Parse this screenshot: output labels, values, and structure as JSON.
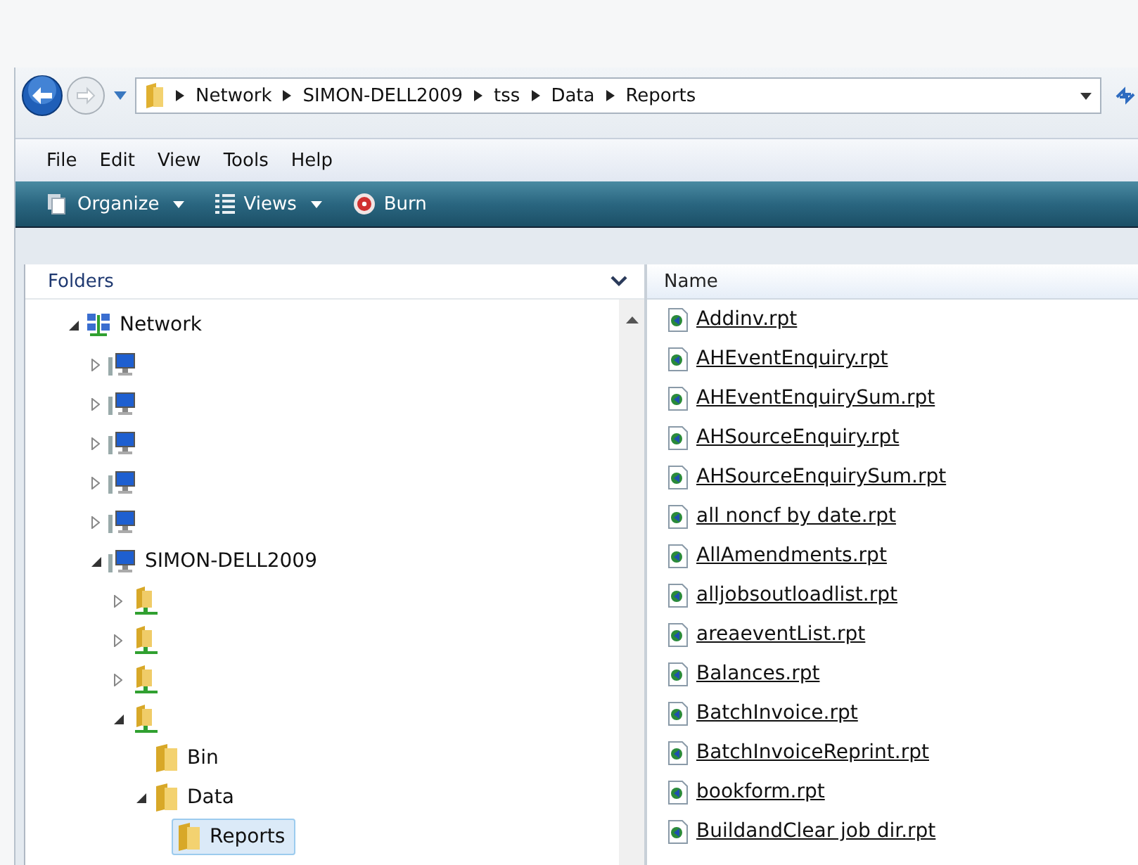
{
  "address_bar": {
    "crumbs": [
      "Network",
      "SIMON-DELL2009",
      "tss",
      "Data",
      "Reports"
    ]
  },
  "menu": [
    "File",
    "Edit",
    "View",
    "Tools",
    "Help"
  ],
  "toolbar": [
    {
      "kind": "organize",
      "label": "Organize",
      "dropdown": true
    },
    {
      "kind": "views",
      "label": "Views",
      "dropdown": true
    },
    {
      "kind": "burn",
      "label": "Burn",
      "dropdown": false
    }
  ],
  "folders_pane": {
    "title": "Folders",
    "tree": [
      {
        "kind": "network",
        "label": "Network",
        "expanded": true,
        "selected": false,
        "children": [
          {
            "kind": "computer",
            "expanded": false,
            "selected": false
          },
          {
            "kind": "computer",
            "expanded": false,
            "selected": false
          },
          {
            "kind": "computer",
            "expanded": false,
            "selected": false
          },
          {
            "kind": "computer",
            "expanded": false,
            "selected": false
          },
          {
            "kind": "computer",
            "expanded": false,
            "selected": false
          },
          {
            "kind": "computer",
            "label": "SIMON-DELL2009",
            "expanded": true,
            "selected": false,
            "children": [
              {
                "kind": "share",
                "expanded": false,
                "selected": false
              },
              {
                "kind": "share",
                "expanded": false,
                "selected": false
              },
              {
                "kind": "share",
                "expanded": false,
                "selected": false
              },
              {
                "kind": "share",
                "expanded": true,
                "selected": false,
                "children": [
                  {
                    "kind": "folder",
                    "label": "Bin",
                    "selected": false
                  },
                  {
                    "kind": "folder",
                    "label": "Data",
                    "expanded": true,
                    "selected": false,
                    "children": [
                      {
                        "kind": "folder",
                        "label": "Reports",
                        "selected": true
                      }
                    ]
                  }
                ]
              }
            ]
          }
        ]
      }
    ]
  },
  "file_list": {
    "columns": [
      "Name"
    ],
    "files": [
      "Addinv.rpt",
      "AHEventEnquiry.rpt",
      "AHEventEnquirySum.rpt",
      "AHSourceEnquiry.rpt",
      "AHSourceEnquirySum.rpt",
      "all noncf by date.rpt",
      "AllAmendments.rpt",
      "alljobsoutloadlist.rpt",
      "areaeventList.rpt",
      "Balances.rpt",
      "BatchInvoice.rpt",
      "BatchInvoiceReprint.rpt",
      "bookform.rpt",
      "BuildandClear job dir.rpt"
    ]
  }
}
